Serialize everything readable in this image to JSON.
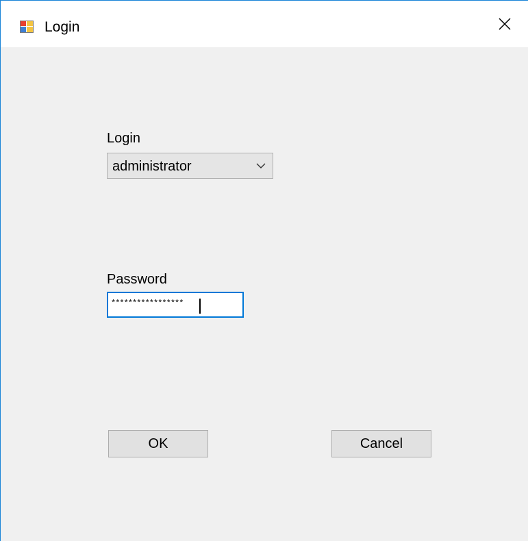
{
  "window": {
    "title": "Login",
    "icon": "winforms-app-icon",
    "close_icon": "close-icon",
    "accent_color": "#0078d7"
  },
  "form": {
    "login_label": "Login",
    "login_value": "administrator",
    "password_label": "Password",
    "password_value": "*****************",
    "ok_label": "OK",
    "cancel_label": "Cancel"
  }
}
